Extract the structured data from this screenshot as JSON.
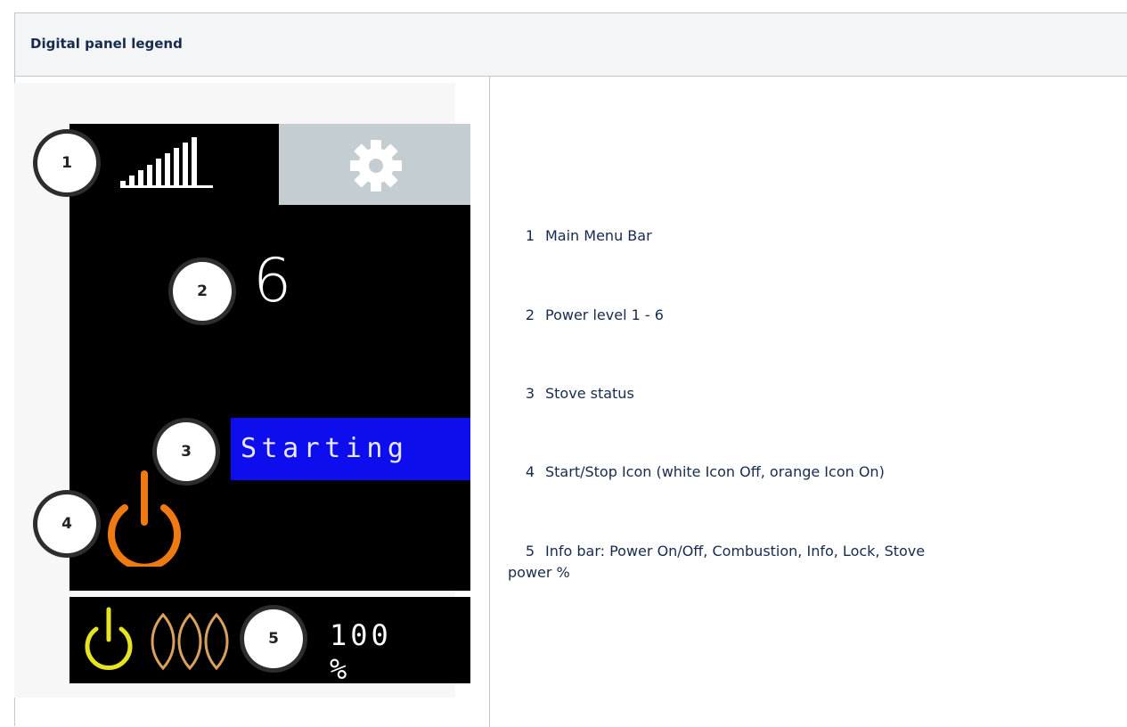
{
  "table": {
    "header": "Digital panel legend"
  },
  "panel": {
    "power_level": "6",
    "status_text": "Starting",
    "stove_power": "100 %",
    "badges": [
      "1",
      "2",
      "3",
      "4",
      "5"
    ],
    "icons": [
      "signal-strength-icon",
      "gear-icon",
      "power-icon",
      "info-power-icon",
      "combustion-flame-icon"
    ],
    "colors": {
      "screen": "#000000",
      "settings_bg": "#c3cdd2",
      "status_bg": "#0d0dee",
      "power_icon_on": "#f07a12",
      "info_power_icon": "#e6e224",
      "flame_icon": "#d9a060"
    }
  },
  "legend": {
    "items": [
      {
        "num": "1",
        "text": "Main Menu Bar"
      },
      {
        "num": "2",
        "text": "Power level 1 - 6"
      },
      {
        "num": "3",
        "text": "Stove status"
      },
      {
        "num": "4",
        "text": "Start/Stop Icon (white Icon Off, orange Icon On)"
      },
      {
        "num": "5",
        "text": "Info bar: Power On/Off, Combustion, Info, Lock, Stove",
        "text_cont": "power %"
      }
    ]
  }
}
